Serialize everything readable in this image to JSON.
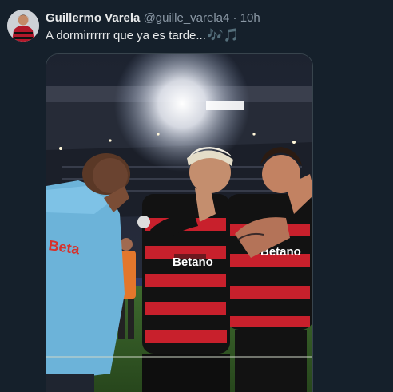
{
  "tweet": {
    "author_name": "Guillermo Varela",
    "handle": "@guille_varela4",
    "separator": "·",
    "time": "10h",
    "text": "A dormirrrrrr que ya es tarde...",
    "emoji": "🎶🎵"
  },
  "media": {
    "jersey_sponsor_left": "Betano",
    "jersey_sponsor_right": "Betano"
  },
  "colors": {
    "background": "#15202b",
    "name": "#e7e9ea",
    "muted": "#8b98a5",
    "accent": "#3c9be8",
    "border": "#38444d"
  }
}
